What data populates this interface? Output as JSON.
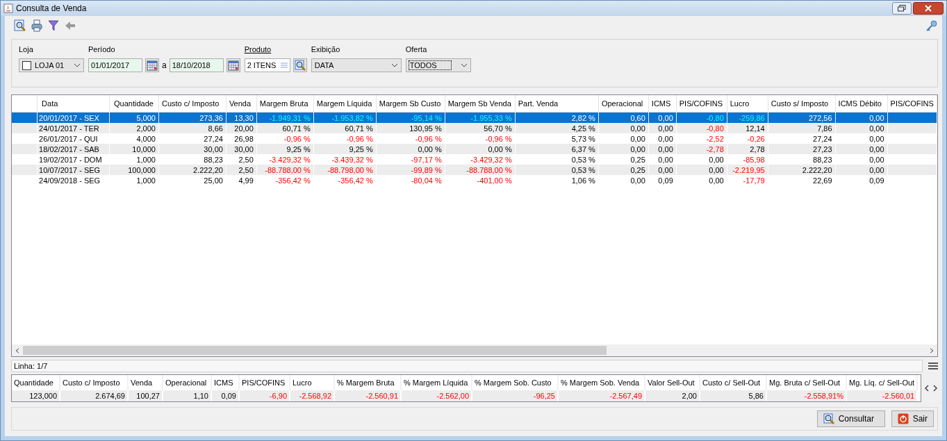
{
  "window": {
    "title": "Consulta de Venda"
  },
  "filters": {
    "loja": {
      "label": "Loja",
      "checked": false,
      "value": "LOJA 01"
    },
    "periodo": {
      "label": "Período",
      "from": "01/01/2017",
      "separator": "a",
      "to": "18/10/2018"
    },
    "produto": {
      "label": "Produto",
      "value": "2 ITENS"
    },
    "exibicao": {
      "label": "Exibição",
      "value": "DATA"
    },
    "oferta": {
      "label": "Oferta",
      "value": "TODOS"
    }
  },
  "table": {
    "columns": [
      "Data",
      "Quantidade",
      "Custo c/ Imposto",
      "Venda",
      "Margem Bruta",
      "Margem Líquida",
      "Margem Sb Custo",
      "Margem Sb Venda",
      "Part. Venda",
      "Operacional",
      "ICMS",
      "PIS/COFINS",
      "Lucro",
      "Custo s/ Imposto",
      "ICMS Débito",
      "PIS/COFINS"
    ],
    "rows": [
      {
        "selected": true,
        "cells": [
          {
            "text": "20/01/2017 - SEX",
            "negative": false
          },
          {
            "text": "5,000",
            "negative": false
          },
          {
            "text": "273,36",
            "negative": false
          },
          {
            "text": "13,30",
            "negative": false
          },
          {
            "text": "-1.949,31 %",
            "negative": true
          },
          {
            "text": "-1.953,82 %",
            "negative": true
          },
          {
            "text": "-95,14 %",
            "negative": true
          },
          {
            "text": "-1.955,33 %",
            "negative": true
          },
          {
            "text": "2,82 %",
            "negative": false
          },
          {
            "text": "0,60",
            "negative": false
          },
          {
            "text": "0,00",
            "negative": false
          },
          {
            "text": "-0,80",
            "negative": true
          },
          {
            "text": "-259,86",
            "negative": true
          },
          {
            "text": "272,56",
            "negative": false
          },
          {
            "text": "0,00",
            "negative": false
          }
        ]
      },
      {
        "selected": false,
        "cells": [
          {
            "text": "24/01/2017 - TER",
            "negative": false
          },
          {
            "text": "2,000",
            "negative": false
          },
          {
            "text": "8,66",
            "negative": false
          },
          {
            "text": "20,00",
            "negative": false
          },
          {
            "text": "60,71 %",
            "negative": false
          },
          {
            "text": "60,71 %",
            "negative": false
          },
          {
            "text": "130,95 %",
            "negative": false
          },
          {
            "text": "56,70 %",
            "negative": false
          },
          {
            "text": "4,25 %",
            "negative": false
          },
          {
            "text": "0,00",
            "negative": false
          },
          {
            "text": "0,00",
            "negative": false
          },
          {
            "text": "-0,80",
            "negative": true
          },
          {
            "text": "12,14",
            "negative": false
          },
          {
            "text": "7,86",
            "negative": false
          },
          {
            "text": "0,00",
            "negative": false
          }
        ]
      },
      {
        "selected": false,
        "cells": [
          {
            "text": "26/01/2017 - QUI",
            "negative": false
          },
          {
            "text": "4,000",
            "negative": false
          },
          {
            "text": "27,24",
            "negative": false
          },
          {
            "text": "26,98",
            "negative": false
          },
          {
            "text": "-0,96 %",
            "negative": true
          },
          {
            "text": "-0,96 %",
            "negative": true
          },
          {
            "text": "-0,96 %",
            "negative": true
          },
          {
            "text": "-0,96 %",
            "negative": true
          },
          {
            "text": "5,73 %",
            "negative": false
          },
          {
            "text": "0,00",
            "negative": false
          },
          {
            "text": "0,00",
            "negative": false
          },
          {
            "text": "-2,52",
            "negative": true
          },
          {
            "text": "-0,26",
            "negative": true
          },
          {
            "text": "27,24",
            "negative": false
          },
          {
            "text": "0,00",
            "negative": false
          }
        ]
      },
      {
        "selected": false,
        "cells": [
          {
            "text": "18/02/2017 - SAB",
            "negative": false
          },
          {
            "text": "10,000",
            "negative": false
          },
          {
            "text": "30,00",
            "negative": false
          },
          {
            "text": "30,00",
            "negative": false
          },
          {
            "text": "9,25 %",
            "negative": false
          },
          {
            "text": "9,25 %",
            "negative": false
          },
          {
            "text": "0,00 %",
            "negative": false
          },
          {
            "text": "0,00 %",
            "negative": false
          },
          {
            "text": "6,37 %",
            "negative": false
          },
          {
            "text": "0,00",
            "negative": false
          },
          {
            "text": "0,00",
            "negative": false
          },
          {
            "text": "-2,78",
            "negative": true
          },
          {
            "text": "2,78",
            "negative": false
          },
          {
            "text": "27,23",
            "negative": false
          },
          {
            "text": "0,00",
            "negative": false
          }
        ]
      },
      {
        "selected": false,
        "cells": [
          {
            "text": "19/02/2017 - DOM",
            "negative": false
          },
          {
            "text": "1,000",
            "negative": false
          },
          {
            "text": "88,23",
            "negative": false
          },
          {
            "text": "2,50",
            "negative": false
          },
          {
            "text": "-3.429,32 %",
            "negative": true
          },
          {
            "text": "-3.439,32 %",
            "negative": true
          },
          {
            "text": "-97,17 %",
            "negative": true
          },
          {
            "text": "-3.429,32 %",
            "negative": true
          },
          {
            "text": "0,53 %",
            "negative": false
          },
          {
            "text": "0,25",
            "negative": false
          },
          {
            "text": "0,00",
            "negative": false
          },
          {
            "text": "0,00",
            "negative": false
          },
          {
            "text": "-85,98",
            "negative": true
          },
          {
            "text": "88,23",
            "negative": false
          },
          {
            "text": "0,00",
            "negative": false
          }
        ]
      },
      {
        "selected": false,
        "cells": [
          {
            "text": "10/07/2017 - SEG",
            "negative": false
          },
          {
            "text": "100,000",
            "negative": false
          },
          {
            "text": "2.222,20",
            "negative": false
          },
          {
            "text": "2,50",
            "negative": false
          },
          {
            "text": "-88.788,00 %",
            "negative": true
          },
          {
            "text": "-88.798,00 %",
            "negative": true
          },
          {
            "text": "-99,89 %",
            "negative": true
          },
          {
            "text": "-88.788,00 %",
            "negative": true
          },
          {
            "text": "0,53 %",
            "negative": false
          },
          {
            "text": "0,25",
            "negative": false
          },
          {
            "text": "0,00",
            "negative": false
          },
          {
            "text": "0,00",
            "negative": false
          },
          {
            "text": "-2.219,95",
            "negative": true
          },
          {
            "text": "2.222,20",
            "negative": false
          },
          {
            "text": "0,00",
            "negative": false
          }
        ]
      },
      {
        "selected": false,
        "cells": [
          {
            "text": "24/09/2018 - SEG",
            "negative": false
          },
          {
            "text": "1,000",
            "negative": false
          },
          {
            "text": "25,00",
            "negative": false
          },
          {
            "text": "4,99",
            "negative": false
          },
          {
            "text": "-356,42 %",
            "negative": true
          },
          {
            "text": "-356,42 %",
            "negative": true
          },
          {
            "text": "-80,04 %",
            "negative": true
          },
          {
            "text": "-401,00 %",
            "negative": true
          },
          {
            "text": "1,06 %",
            "negative": false
          },
          {
            "text": "0,00",
            "negative": false
          },
          {
            "text": "0,09",
            "negative": false
          },
          {
            "text": "0,00",
            "negative": false
          },
          {
            "text": "-17,79",
            "negative": true
          },
          {
            "text": "22,69",
            "negative": false
          },
          {
            "text": "0,09",
            "negative": false
          }
        ]
      }
    ]
  },
  "status_bar": {
    "text": "Linha: 1/7"
  },
  "totals": [
    {
      "label": "Quantidade",
      "text": "123,000",
      "negative": false
    },
    {
      "label": "Custo c/ Imposto",
      "text": "2.674,69",
      "negative": false
    },
    {
      "label": "Venda",
      "text": "100,27",
      "negative": false
    },
    {
      "label": "Operacional",
      "text": "1,10",
      "negative": false
    },
    {
      "label": "ICMS",
      "text": "0,09",
      "negative": false
    },
    {
      "label": "PIS/COFINS",
      "text": "-6,90",
      "negative": true
    },
    {
      "label": "Lucro",
      "text": "-2.568,92",
      "negative": true
    },
    {
      "label": "% Margem Bruta",
      "text": "-2.560,91",
      "negative": true
    },
    {
      "label": "% Margem Líquida",
      "text": "-2.562,00",
      "negative": true
    },
    {
      "label": "% Margem Sob. Custo",
      "text": "-96,25",
      "negative": true
    },
    {
      "label": "% Margem Sob. Venda",
      "text": "-2.567,49",
      "negative": true
    },
    {
      "label": "Valor Sell-Out",
      "text": "2,00",
      "negative": false
    },
    {
      "label": "Custo c/ Sell-Out",
      "text": "5,86",
      "negative": false
    },
    {
      "label": "Mg. Bruta c/ Sell-Out",
      "text": "-2.558,91%",
      "negative": true
    },
    {
      "label": "Mg. Líq. c/ Sell-Out",
      "text": "-2.560,01",
      "negative": true
    }
  ],
  "buttons": [
    "Consultar",
    "Sair"
  ]
}
